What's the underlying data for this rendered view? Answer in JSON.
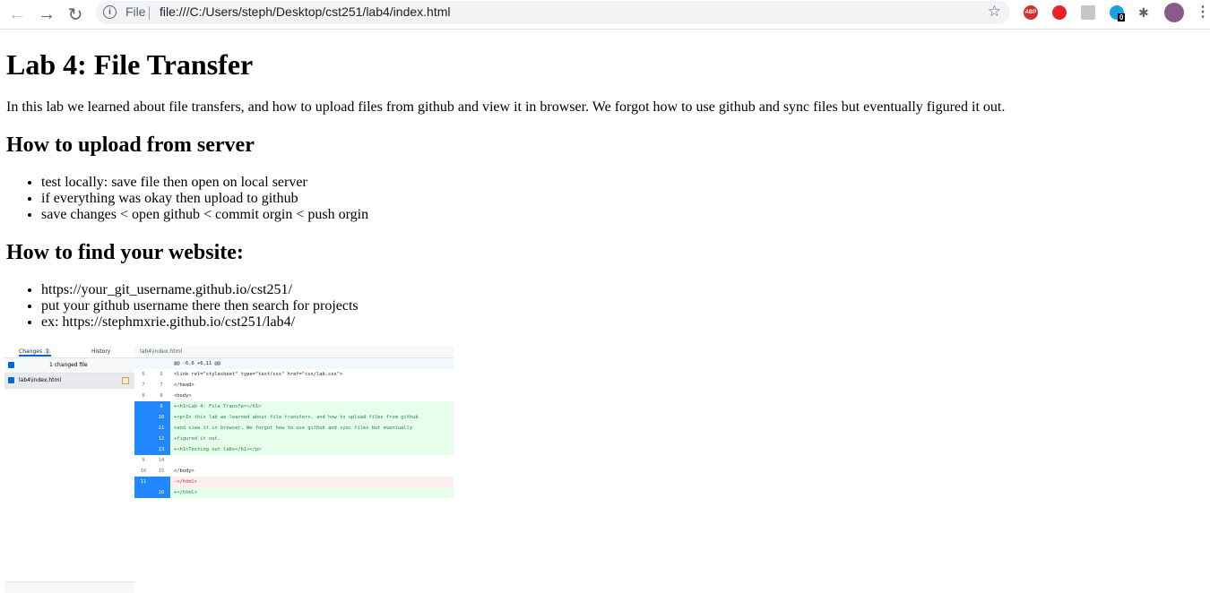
{
  "browser": {
    "scheme": "File",
    "url": "file:///C:/Users/steph/Desktop/cst251/lab4/index.html",
    "icons": [
      "back-icon",
      "forward-icon",
      "reload-icon",
      "info-icon",
      "star-icon",
      "adblock-icon",
      "ublock-icon",
      "extension-icon",
      "ghostery-icon",
      "puzzle-icon",
      "avatar",
      "menu-icon"
    ],
    "ghostery_badge": "0"
  },
  "page": {
    "title": "Lab 4: File Transfer",
    "intro": "In this lab we learned about file transfers, and how to upload files from github and view it in browser. We forgot how to use github and sync files but eventually figured it out.",
    "section1": {
      "heading": "How to upload from server",
      "items": [
        "test locally: save file then open on local server",
        "if everything was okay then upload to github",
        "save changes < open github < commit orgin < push orgin"
      ]
    },
    "section2": {
      "heading": "How to find your website:",
      "items": [
        "https://your_git_username.github.io/cst251/",
        "put your github username there then search for projects",
        "ex: https://stephmxrie.github.io/cst251/lab4/"
      ]
    }
  },
  "screenshot": {
    "tab_changes": "Changes",
    "tab_changes_count": "1",
    "tab_history": "History",
    "changed_summary": "1 changed file",
    "file_name": "lab4\\index.html",
    "diff_header": "lab4\\index.html",
    "rows": [
      {
        "a": "",
        "b": "",
        "code": "@@ -6,6 +6,11 @@",
        "type": "hunk"
      },
      {
        "a": "6",
        "b": "6",
        "code": "    <link rel=\"stylesheet\" type=\"text/css\" href=\"css/lab.css\">",
        "type": "ctx"
      },
      {
        "a": "7",
        "b": "7",
        "code": "  </head>",
        "type": "ctx"
      },
      {
        "a": "8",
        "b": "8",
        "code": "  <body>",
        "type": "ctx"
      },
      {
        "a": "",
        "b": "9",
        "code": "+<h1>Lab 4: File Transfer</h1>",
        "type": "add"
      },
      {
        "a": "",
        "b": "10",
        "code": "+<p>In this lab we learned about file transfers, and how to upload files from github",
        "type": "add"
      },
      {
        "a": "",
        "b": "11",
        "code": "+and view it in browser. We forgot how to use github and sync files but eventually",
        "type": "add"
      },
      {
        "a": "",
        "b": "12",
        "code": "+figured it out.",
        "type": "add"
      },
      {
        "a": "",
        "b": "13",
        "code": "+<h1>Testing out labs</h1></p>",
        "type": "add"
      },
      {
        "a": "9",
        "b": "14",
        "code": "",
        "type": "ctx"
      },
      {
        "a": "10",
        "b": "15",
        "code": "  </body>",
        "type": "ctx"
      },
      {
        "a": "11",
        "b": "",
        "code": "-</html>",
        "type": "del"
      },
      {
        "a": "",
        "b": "16",
        "code": "+</html>",
        "type": "add"
      }
    ]
  }
}
